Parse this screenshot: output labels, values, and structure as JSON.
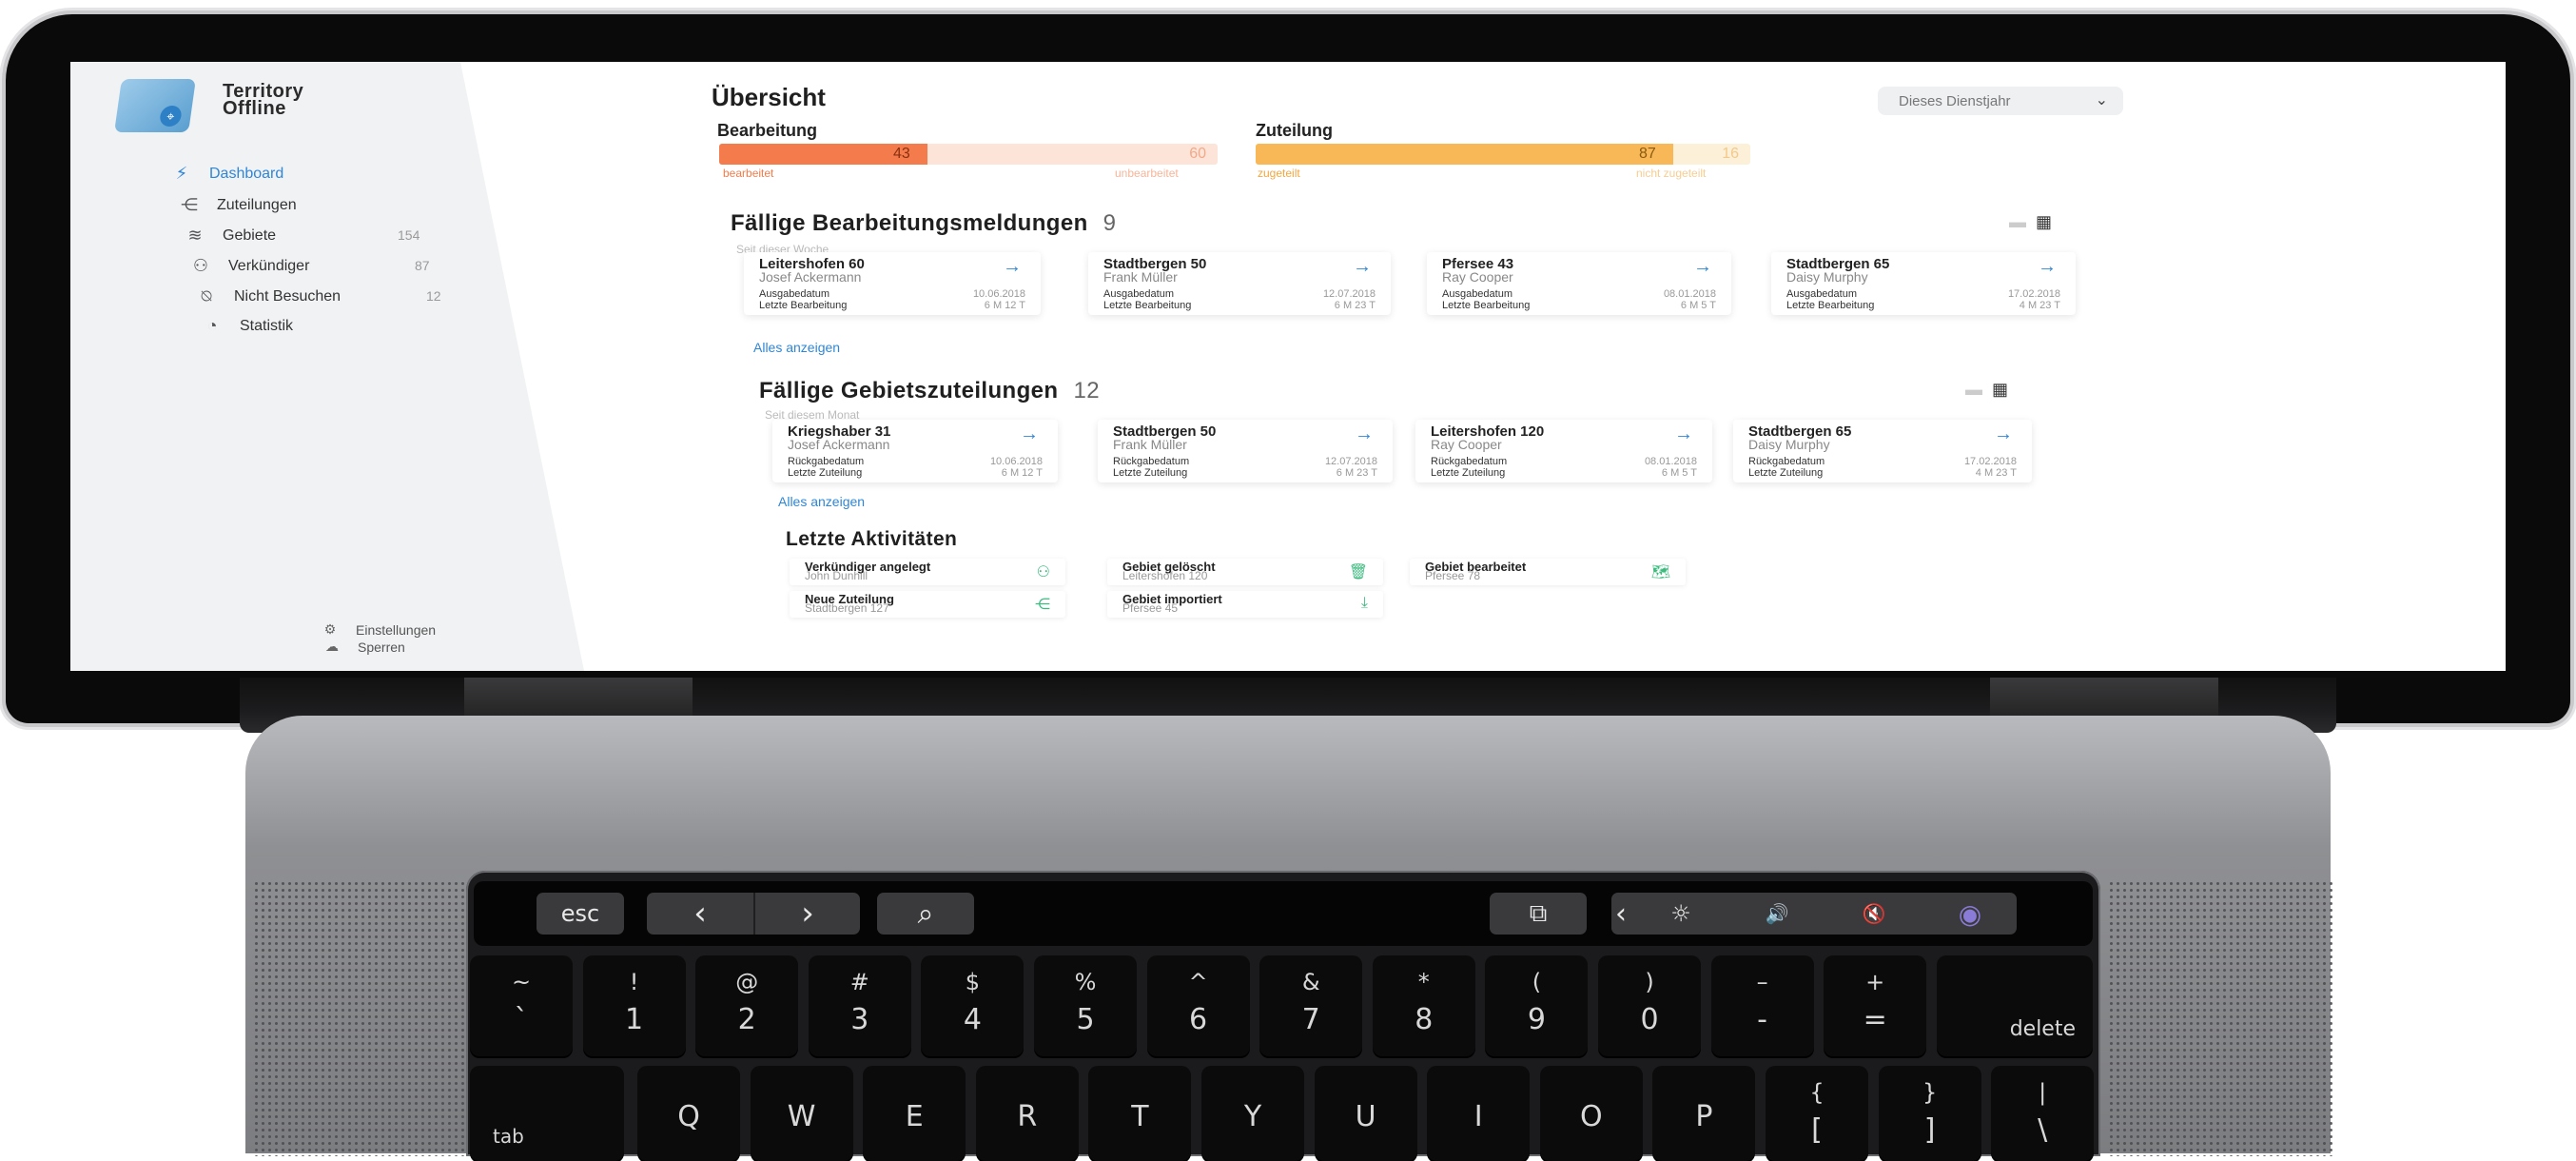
{
  "app": {
    "title_line1": "Territory",
    "title_line2": "Offline"
  },
  "sidebar": {
    "items": [
      {
        "label": "Dashboard",
        "icon": "activity-icon",
        "count": ""
      },
      {
        "label": "Zuteilungen",
        "icon": "share-icon",
        "count": ""
      },
      {
        "label": "Gebiete",
        "icon": "layers-icon",
        "count": "154"
      },
      {
        "label": "Verkündiger",
        "icon": "users-icon",
        "count": "87"
      },
      {
        "label": "Nicht Besuchen",
        "icon": "bell-off-icon",
        "count": "12"
      },
      {
        "label": "Statistik",
        "icon": "pie-chart-icon",
        "count": ""
      }
    ],
    "bottom": [
      {
        "label": "Einstellungen",
        "icon": "gear-icon"
      },
      {
        "label": "Sperren",
        "icon": "cloud-icon"
      }
    ]
  },
  "header": {
    "title": "Übersicht",
    "period": "Dieses Dienstjahr"
  },
  "progress": {
    "processing": {
      "label": "Bearbeitung",
      "done": "43",
      "open": "60",
      "done_label": "bearbeitet",
      "open_label": "unbearbeitet",
      "done_fraction": 0.417,
      "color": "#f47c4c",
      "track": "#fde4d9"
    },
    "assignment": {
      "label": "Zuteilung",
      "done": "87",
      "open": "16",
      "done_label": "zugeteilt",
      "open_label": "nicht zugeteilt",
      "done_fraction": 0.845,
      "color": "#f9b857",
      "track": "#fdf0d8"
    }
  },
  "due_processing": {
    "title": "Fällige Bearbeitungsmeldungen",
    "count": "9",
    "subtitle": "Seit dieser Woche",
    "show_all": "Alles anzeigen",
    "row1_label": "Ausgabedatum",
    "row2_label": "Letzte Bearbeitung",
    "cards": [
      {
        "name": "Leitershofen 60",
        "person": "Josef Ackermann",
        "date": "10.06.2018",
        "elapsed": "6 M 12 T"
      },
      {
        "name": "Stadtbergen 50",
        "person": "Frank Müller",
        "date": "12.07.2018",
        "elapsed": "6 M 23 T"
      },
      {
        "name": "Pfersee 43",
        "person": "Ray Cooper",
        "date": "08.01.2018",
        "elapsed": "6 M 5 T"
      },
      {
        "name": "Stadtbergen 65",
        "person": "Daisy Murphy",
        "date": "17.02.2018",
        "elapsed": "4 M 23 T"
      }
    ]
  },
  "due_assignment": {
    "title": "Fällige Gebietszuteilungen",
    "count": "12",
    "subtitle": "Seit diesem Monat",
    "show_all": "Alles anzeigen",
    "row1_label": "Rückgabedatum",
    "row2_label": "Letzte Zuteilung",
    "cards": [
      {
        "name": "Kriegshaber 31",
        "person": "Josef Ackermann",
        "date": "10.06.2018",
        "elapsed": "6 M 12 T"
      },
      {
        "name": "Stadtbergen 50",
        "person": "Frank Müller",
        "date": "12.07.2018",
        "elapsed": "6 M 23 T"
      },
      {
        "name": "Leitershofen 120",
        "person": "Ray Cooper",
        "date": "08.01.2018",
        "elapsed": "6 M 5 T"
      },
      {
        "name": "Stadtbergen 65",
        "person": "Daisy Murphy",
        "date": "17.02.2018",
        "elapsed": "4 M 23 T"
      }
    ]
  },
  "activities": {
    "title": "Letzte Aktivitäten",
    "items": [
      {
        "title": "Verkündiger angelegt",
        "sub": "John Dunhill",
        "icon": "user-add-icon"
      },
      {
        "title": "Gebiet gelöscht",
        "sub": "Leitershofen 120",
        "icon": "trash-icon"
      },
      {
        "title": "Gebiet bearbeitet",
        "sub": "Pfersee 78",
        "icon": "map-icon"
      },
      {
        "title": "Neue Zuteilung",
        "sub": "Stadtbergen 127",
        "icon": "share-icon"
      },
      {
        "title": "Gebiet importiert",
        "sub": "Pfersee 45",
        "icon": "download-icon"
      }
    ]
  },
  "touchbar": {
    "esc": "esc",
    "back": "‹",
    "forward": "›",
    "search": "⌕",
    "screens": "⧉",
    "collapse": "‹",
    "brightness": "☼",
    "volume": "🔊",
    "mute": "🔇",
    "siri": "◉"
  },
  "keyboard": {
    "row1": [
      {
        "top": "~",
        "bottom": "`"
      },
      {
        "top": "!",
        "bottom": "1"
      },
      {
        "top": "@",
        "bottom": "2"
      },
      {
        "top": "#",
        "bottom": "3"
      },
      {
        "top": "$",
        "bottom": "4"
      },
      {
        "top": "%",
        "bottom": "5"
      },
      {
        "top": "^",
        "bottom": "6"
      },
      {
        "top": "&",
        "bottom": "7"
      },
      {
        "top": "*",
        "bottom": "8"
      },
      {
        "top": "(",
        "bottom": "9"
      },
      {
        "top": ")",
        "bottom": "0"
      },
      {
        "top": "–",
        "bottom": "-"
      },
      {
        "top": "+",
        "bottom": "="
      }
    ],
    "delete": "delete",
    "tab": "tab",
    "row2": [
      "Q",
      "W",
      "E",
      "R",
      "T",
      "Y",
      "U",
      "I",
      "O",
      "P"
    ],
    "row2_extra": [
      {
        "top": "{",
        "bottom": "["
      },
      {
        "top": "}",
        "bottom": "]"
      },
      {
        "top": "|",
        "bottom": "\\"
      }
    ]
  }
}
